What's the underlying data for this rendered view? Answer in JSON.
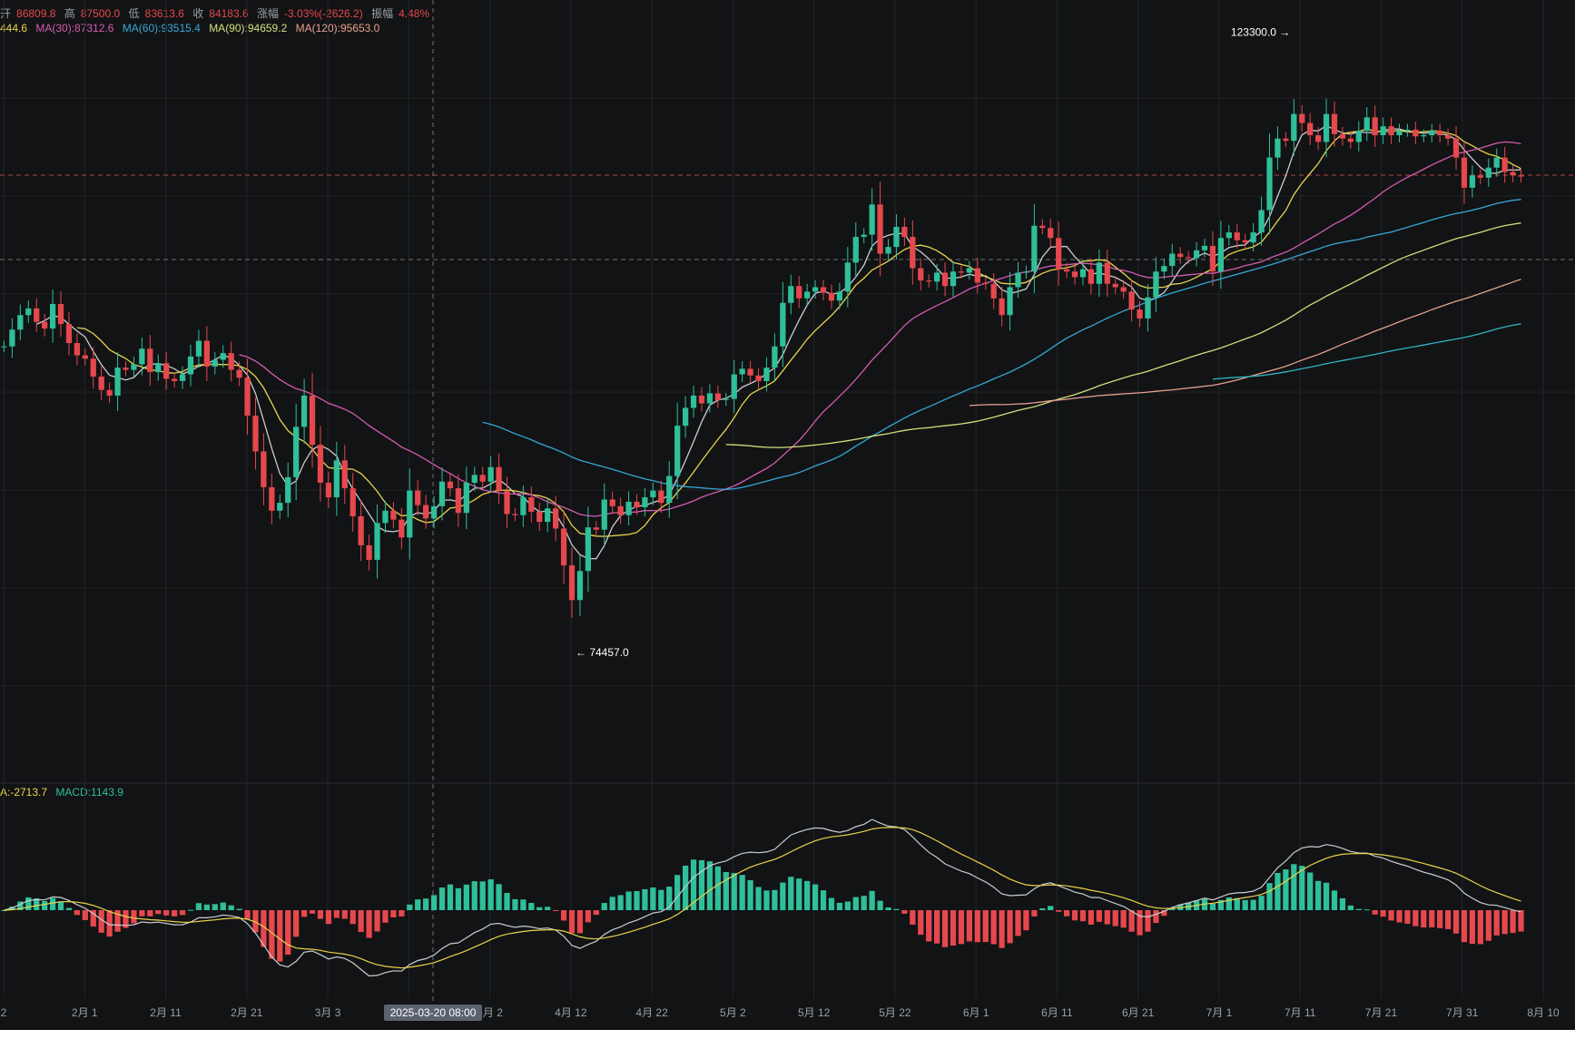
{
  "ohlc": {
    "open_label": "开",
    "open": "86809.8",
    "high_label": "高",
    "high": "87500.0",
    "low_label": "低",
    "low": "83613.6",
    "close_label": "收",
    "close": "84183.6",
    "change_label": "涨幅",
    "change": "-3.03%(-2626.2)",
    "amp_label": "振幅",
    "amp": "4.48%"
  },
  "ma_legend": {
    "ma_partial": "444.6",
    "ma30": "MA(30):87312.6",
    "ma60": "MA(60):93515.4",
    "ma90": "MA(90):94659.2",
    "ma120": "MA(120):95653.0"
  },
  "macd_legend": {
    "dea": "A:-2713.7",
    "macd": "MACD:1143.9"
  },
  "annotations": {
    "high_marker": "123300.0 →",
    "low_marker": "← 74457.0"
  },
  "crosshair_label": "2025-03-20 08:00",
  "colors": {
    "background": "#121314",
    "up": "#2fbf9a",
    "down": "#e5484d",
    "ma5": "#c9cdd1",
    "ma10": "#e8d44d",
    "ma30": "#d35bb0",
    "ma60": "#35a7d8",
    "ma90": "#cfe07a",
    "ma120": "#e7a08f",
    "ma_long": "#2fb3c4",
    "macd_dif": "#c9cdd1",
    "macd_dea": "#e8d44d"
  },
  "chart_data": {
    "type": "candlestick",
    "title": "",
    "x_ticks": [
      "2",
      "2月 1",
      "2月 11",
      "2月 21",
      "3月 3",
      "3月",
      "4月 2",
      "4月 12",
      "4月 22",
      "5月 2",
      "5月 12",
      "5月 22",
      "6月 1",
      "6月 11",
      "6月 21",
      "7月 1",
      "7月 11",
      "7月 21",
      "7月 31",
      "8月 10"
    ],
    "price_range": [
      60000,
      130000
    ],
    "grid": true,
    "closes": [
      99000,
      100500,
      101800,
      102400,
      101200,
      100600,
      102800,
      101000,
      99300,
      98200,
      97900,
      96300,
      95100,
      94600,
      97100,
      96900,
      97400,
      98800,
      96700,
      97500,
      96100,
      95900,
      96500,
      98100,
      99500,
      97200,
      97800,
      98400,
      96900,
      96200,
      92800,
      89600,
      86400,
      84300,
      85000,
      87300,
      91800,
      94600,
      90200,
      86800,
      85500,
      88800,
      86300,
      83800,
      81200,
      79900,
      83200,
      84300,
      83500,
      81900,
      86100,
      84800,
      83600,
      84700,
      86900,
      86300,
      84100,
      86800,
      87500,
      86900,
      88200,
      86100,
      84000,
      83900,
      85500,
      84200,
      83300,
      84500,
      82700,
      79400,
      76300,
      78900,
      82800,
      82600,
      85300,
      84700,
      83900,
      85100,
      84600,
      85500,
      86100,
      85000,
      87400,
      91900,
      93500,
      94600,
      93900,
      94800,
      94200,
      94300,
      96500,
      97000,
      96400,
      95900,
      97100,
      99000,
      102900,
      104400,
      103300,
      103900,
      104300,
      103800,
      103100,
      103900,
      106500,
      108800,
      109000,
      111700,
      107300,
      107900,
      109700,
      108800,
      106000,
      104900,
      104800,
      105600,
      104400,
      105700,
      105600,
      106000,
      104700,
      104600,
      103300,
      101800,
      104300,
      105600,
      105700,
      109800,
      109600,
      108700,
      105900,
      105700,
      105200,
      105900,
      104600,
      106500,
      104600,
      104300,
      103900,
      102300,
      101500,
      103400,
      105700,
      106200,
      107300,
      107000,
      106900,
      107600,
      108000,
      105700,
      108700,
      109200,
      108500,
      108300,
      109200,
      111200,
      115900,
      117600,
      117400,
      119800,
      119000,
      117900,
      117300,
      119800,
      118000,
      117600,
      117300,
      118300,
      119500,
      117900,
      118700,
      117900,
      118300,
      118400,
      117800,
      117900,
      118300,
      117900,
      117600,
      115900,
      113200,
      114300,
      114100,
      115000,
      115900,
      114600,
      114300,
      114200
    ],
    "macd": {
      "hist_range": [
        -1.0,
        1.0
      ],
      "dif_dea_range": [
        -1.0,
        1.0
      ]
    }
  }
}
